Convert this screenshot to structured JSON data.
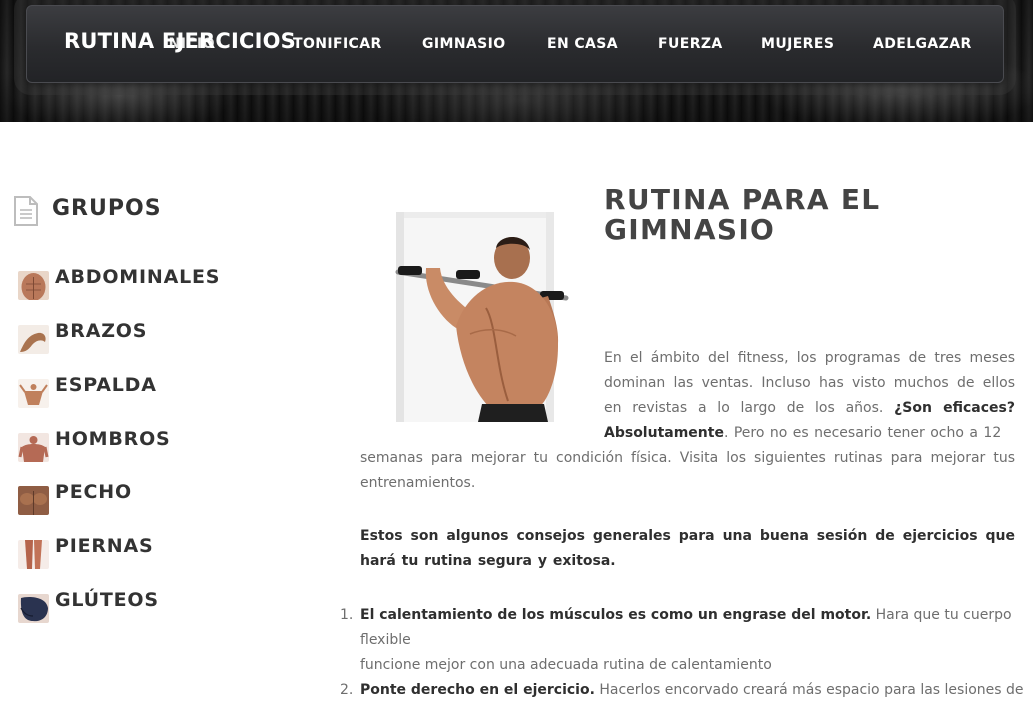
{
  "brand": "RUTINA EJERCICIOS",
  "nav": [
    {
      "label": "INICIO"
    },
    {
      "label": "TONIFICAR"
    },
    {
      "label": "GIMNASIO"
    },
    {
      "label": "EN CASA"
    },
    {
      "label": "FUERZA"
    },
    {
      "label": "MUJERES"
    },
    {
      "label": "ADELGAZAR"
    }
  ],
  "sidebar": {
    "title": "GRUPOS",
    "title_icon": "document-icon",
    "items": [
      {
        "label": "ABDOMINALES",
        "icon": "abs-thumbnail",
        "color": "#b9785a"
      },
      {
        "label": "BRAZOS",
        "icon": "arm-thumbnail",
        "color": "#a9734f"
      },
      {
        "label": "ESPALDA",
        "icon": "back-thumbnail",
        "color": "#c0805c"
      },
      {
        "label": "HOMBROS",
        "icon": "shoulders-thumbnail",
        "color": "#b56a55"
      },
      {
        "label": "PECHO",
        "icon": "chest-thumbnail",
        "color": "#8f5d44"
      },
      {
        "label": "PIERNAS",
        "icon": "legs-thumbnail",
        "color": "#b5644c"
      },
      {
        "label": "GLÚTEOS",
        "icon": "glutes-thumbnail",
        "color": "#2a3350"
      }
    ]
  },
  "main": {
    "title_line1": "RUTINA PARA EL",
    "title_line2": "GIMNASIO",
    "image": "pull-up-bar-photo",
    "intro": {
      "part1": "En el ámbito del fitness, los programas de tres meses dominan las ventas. Incluso has visto muchos de ellos en revistas a lo largo de los años. ",
      "bold": "¿Son eficaces? Absolutamente",
      "part2": ". Pero no es necesario tener ocho a 12",
      "part3": "semanas para mejorar tu condición física. Visita los siguientes rutinas para mejorar tus entrenamientos."
    },
    "tips_intro": "Estos son algunos consejos generales para una buena sesión de ejercicios que hará tu rutina segura y exitosa.",
    "steps": [
      {
        "num": "1.",
        "bold": "El calentamiento de los músculos es como un engrase del motor.",
        "text": " Hara que tu cuerpo flexible",
        "text2": "funcione mejor con una adecuada rutina de calentamiento"
      },
      {
        "num": "2.",
        "bold": "Ponte derecho en el ejercicio.",
        "text": " Hacerlos encorvado creará más espacio para las lesiones de"
      }
    ]
  },
  "colors": {
    "heading": "#444444",
    "body_text": "#6e6e6e",
    "nav_bg": "#2a2b2e"
  }
}
